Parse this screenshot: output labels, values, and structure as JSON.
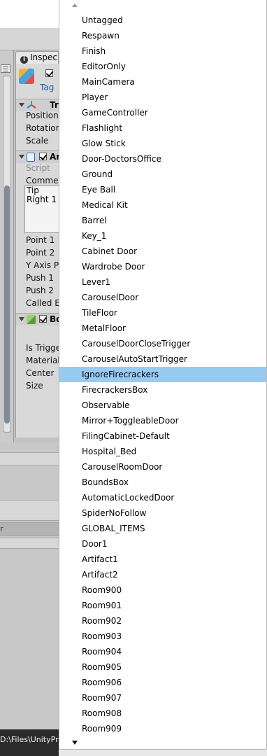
{
  "inspector": {
    "tab_label": "Inspec",
    "tag_label": "Tag",
    "transform_title": "Tr",
    "transform_fields": [
      "Position",
      "Rotation",
      "Scale"
    ],
    "script_component_title": "Ar",
    "script_label": "Script",
    "comment_label": "Comme",
    "comment_text_line1": "Tip",
    "comment_text_line2": "Right 1",
    "script_fields": [
      "Point 1",
      "Point 2",
      "Y Axis P",
      "Push 1",
      "Push 2",
      "Called E"
    ],
    "box_component_title": "Bo",
    "box_fields": [
      "Is Trigge",
      "Material",
      "Center",
      "Size"
    ]
  },
  "lower_panel": {
    "label": "r"
  },
  "status_bar": {
    "path_text": "D:\\Files\\UnityPro"
  },
  "dropdown": {
    "selected_index": 23,
    "items": [
      "Untagged",
      "Respawn",
      "Finish",
      "EditorOnly",
      "MainCamera",
      "Player",
      "GameController",
      "Flashlight",
      "Glow Stick",
      "Door-DoctorsOffice",
      "Ground",
      "Eye Ball",
      "Medical Kit",
      "Barrel",
      "Key_1",
      "Cabinet Door",
      "Wardrobe Door",
      "Lever1",
      "CarouselDoor",
      "TileFloor",
      "MetalFloor",
      "CarouselDoorCloseTrigger",
      "CarouselAutoStartTrigger",
      "IgnoreFirecrackers",
      "FirecrackersBox",
      "Observable",
      "Mirror+ToggleableDoor",
      "FilingCabinet-Default",
      "Hospital_Bed",
      "CarouselRoomDoor",
      "BoundsBox",
      "AutomaticLockedDoor",
      "SpiderNoFollow",
      "GLOBAL_ITEMS",
      "Door1",
      "Artifact1",
      "Artifact2",
      "Room900",
      "Room901",
      "Room902",
      "Room903",
      "Room904",
      "Room905",
      "Room906",
      "Room907",
      "Room908",
      "Room909"
    ]
  },
  "colors": {
    "selection": "#99cbf2",
    "status_bar": "#2b2b2b"
  }
}
